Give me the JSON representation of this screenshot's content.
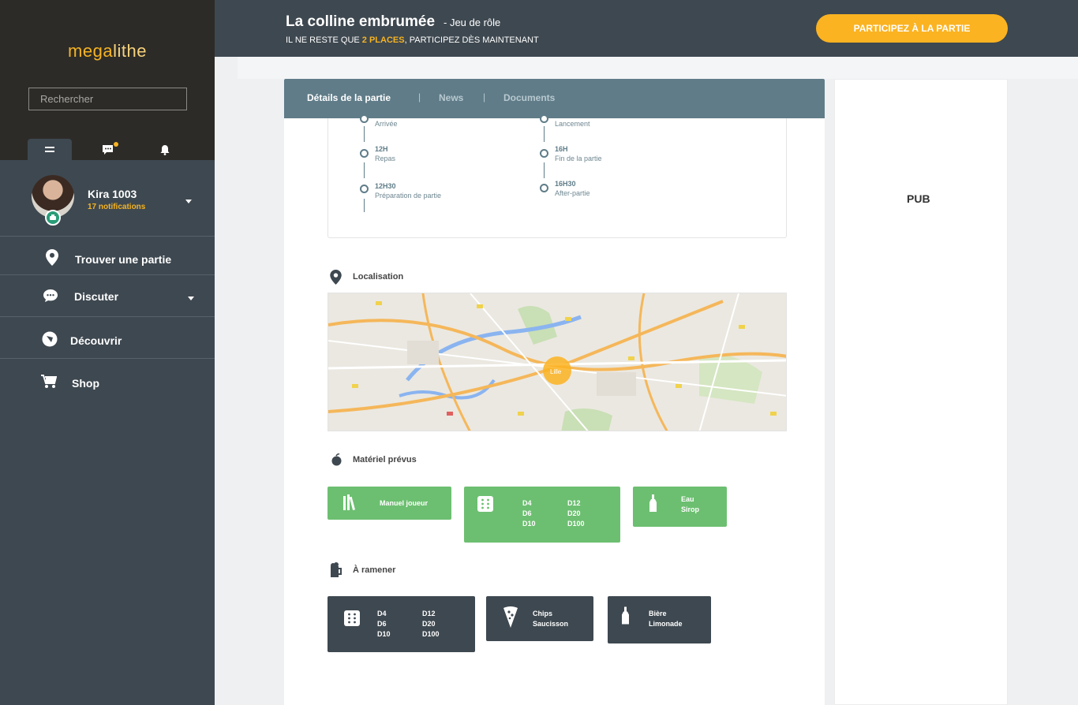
{
  "sidebar": {
    "logo_a": "mega",
    "logo_b": "lithe",
    "search_placeholder": "Rechercher",
    "profile": {
      "name": "Kira 1003",
      "notifications": "17 notifications"
    },
    "nav": [
      {
        "label": "Trouver une partie"
      },
      {
        "label": "Discuter"
      },
      {
        "label": "Découvrir"
      },
      {
        "label": "Shop"
      }
    ]
  },
  "header": {
    "title": "La colline embrumée",
    "subtitle": "-  Jeu de rôle",
    "places_prefix": "IL NE RESTE QUE ",
    "places_count": "2 PLACES",
    "places_suffix": ", PARTICIPEZ DÈS MAINTENANT",
    "cta": "PARTICIPEZ À LA PARTIE"
  },
  "tabs": [
    "Détails de la partie",
    "News",
    "Documents"
  ],
  "tab_separator": "|",
  "timeline": {
    "left": [
      {
        "time": "",
        "desc": "Arrivée"
      },
      {
        "time": "12H",
        "desc": "Repas"
      },
      {
        "time": "12H30",
        "desc": "Préparation de partie"
      }
    ],
    "right": [
      {
        "time": "",
        "desc": "Lancement"
      },
      {
        "time": "16H",
        "desc": "Fin de la partie"
      },
      {
        "time": "16H30",
        "desc": "After-partie"
      }
    ]
  },
  "localisation": {
    "title": "Localisation",
    "marker_label": "Lille"
  },
  "materiel": {
    "title": "Matériel prévus",
    "manuel": "Manuel joueur",
    "des_col1": [
      "D4",
      "D6",
      "D10"
    ],
    "des_col2": [
      "D12",
      "D20",
      "D100"
    ],
    "boissons": [
      "Eau",
      "Sirop"
    ]
  },
  "ramener": {
    "title": "À ramener",
    "des_col1": [
      "D4",
      "D6",
      "D10"
    ],
    "des_col2": [
      "D12",
      "D20",
      "D100"
    ],
    "snacks": [
      "Chips",
      "Saucisson"
    ],
    "boissons": [
      "Bière",
      "Limonade"
    ]
  },
  "pub": "PUB",
  "colors": {
    "accent": "#fbb321",
    "dark": "#3e4850",
    "green": "#6cbf70",
    "teal": "#5f7c88"
  }
}
